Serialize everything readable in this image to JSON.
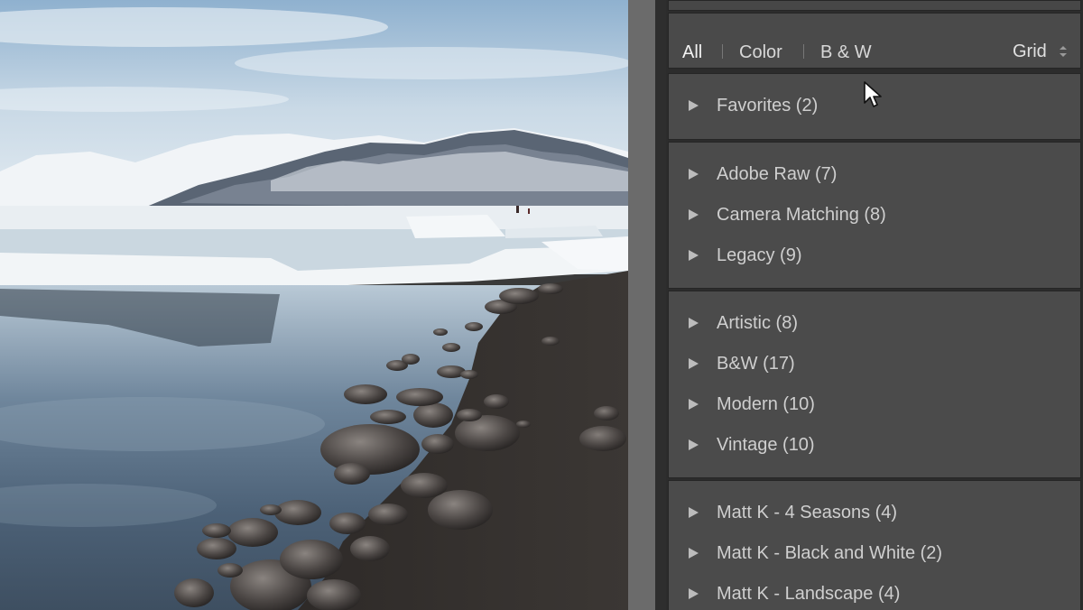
{
  "filters": {
    "all": "All",
    "color": "Color",
    "bw": "B & W",
    "view": "Grid"
  },
  "groups": [
    {
      "items": [
        {
          "label": "Favorites (2)"
        }
      ]
    },
    {
      "items": [
        {
          "label": "Adobe Raw (7)"
        },
        {
          "label": "Camera Matching (8)"
        },
        {
          "label": "Legacy (9)"
        }
      ]
    },
    {
      "items": [
        {
          "label": "Artistic (8)"
        },
        {
          "label": "B&W (17)"
        },
        {
          "label": "Modern (10)"
        },
        {
          "label": "Vintage (10)"
        }
      ]
    },
    {
      "items": [
        {
          "label": "Matt K - 4 Seasons (4)"
        },
        {
          "label": "Matt K - Black and White (2)"
        },
        {
          "label": "Matt K - Landscape (4)"
        }
      ]
    }
  ],
  "icons": {
    "expand": "disclosure-triangle-icon",
    "view_dropdown": "updown-arrows-icon",
    "cursor": "mouse-pointer-icon"
  },
  "colors": {
    "panel_bg": "#4b4b4b",
    "text": "#cfcfcf",
    "active_text": "#f2f2f2"
  }
}
